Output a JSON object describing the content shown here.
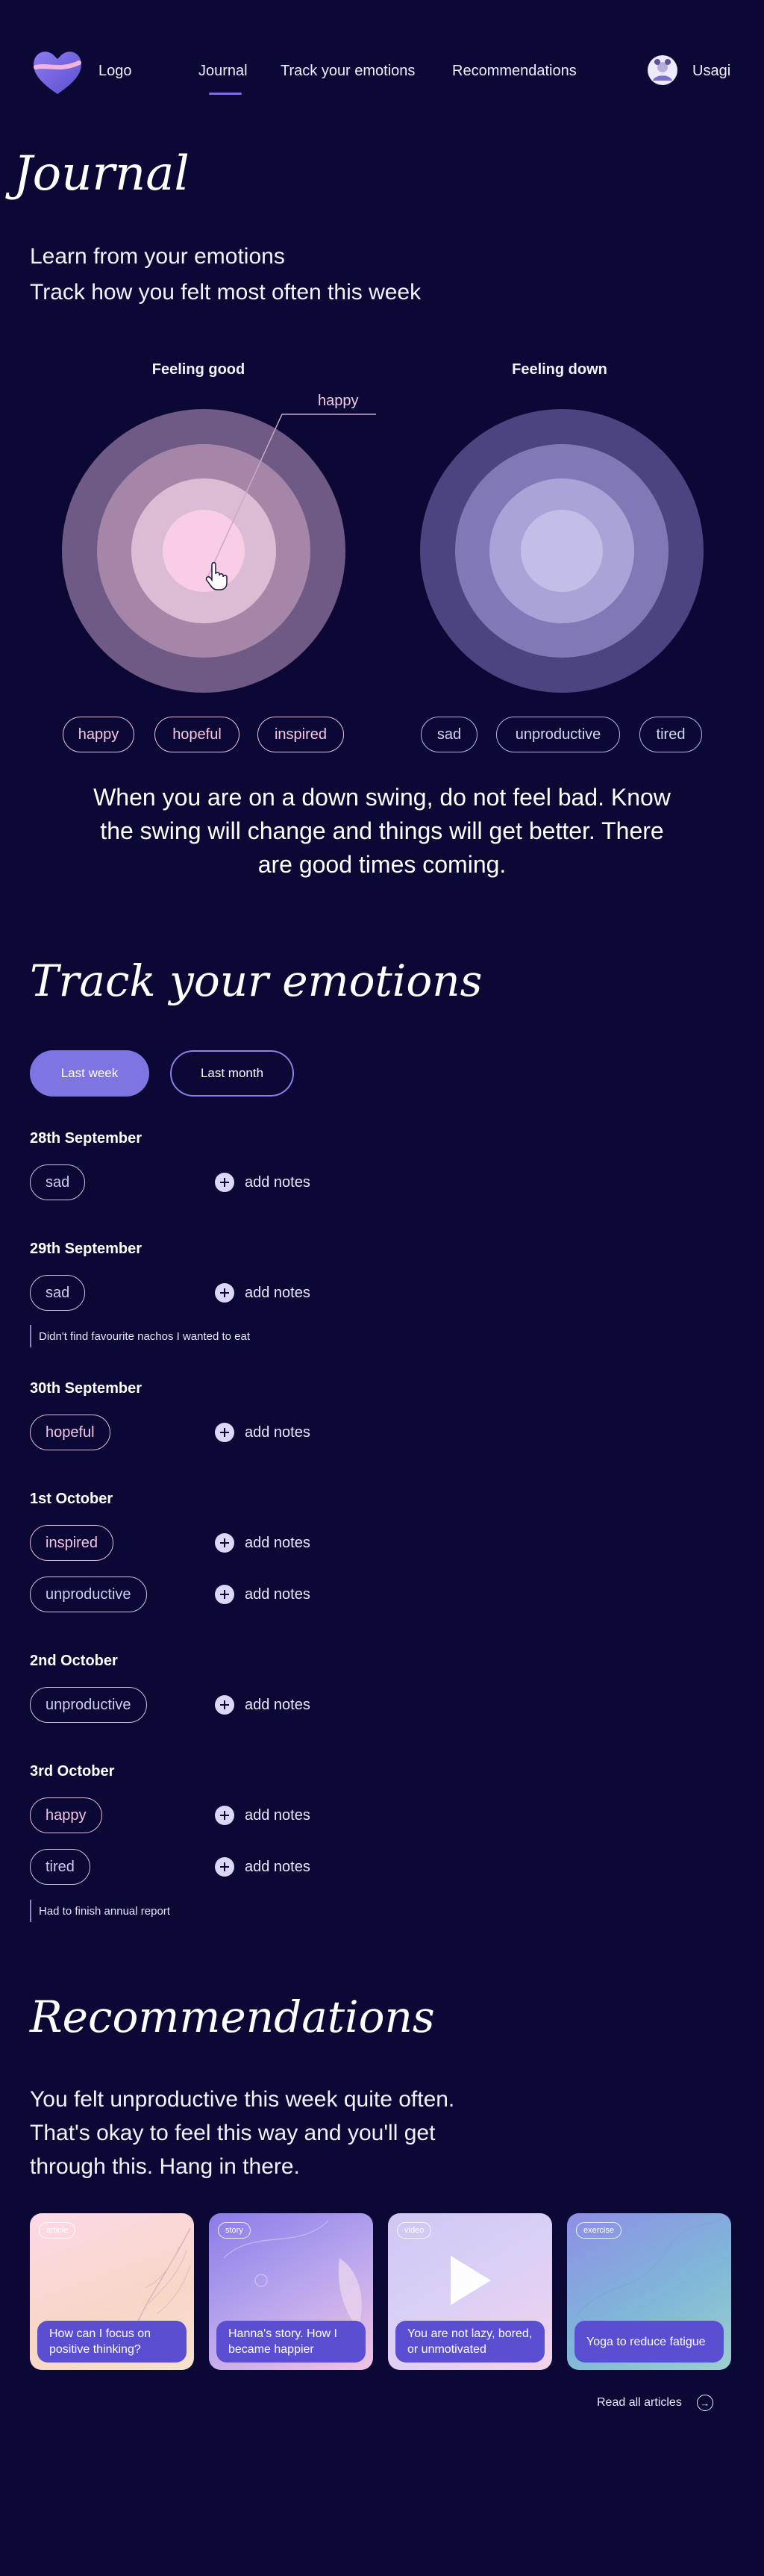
{
  "header": {
    "logo_text": "Logo",
    "nav": [
      "Journal",
      "Track your emotions",
      "Recommendations"
    ],
    "active_nav": "Journal",
    "user_name": "Usagi"
  },
  "journal": {
    "title": "Journal",
    "subtitle_line1": "Learn from your emotions",
    "subtitle_line2": "Track how you felt most often this week",
    "charts": [
      {
        "title": "Feeling good",
        "tooltip": "happy",
        "emotions": [
          "happy",
          "hopeful",
          "inspired"
        ],
        "colors": [
          "#6f5a85",
          "#a585a8",
          "#dcbcd4",
          "#f8cde5",
          "#ffd6ec"
        ]
      },
      {
        "title": "Feeling down",
        "emotions": [
          "sad",
          "unproductive",
          "tired"
        ],
        "colors": [
          "#4b4480",
          "#7f79b8",
          "#a8a4d8",
          "#c2bee8"
        ]
      }
    ],
    "quote": "When you are on a down swing, do not feel bad. Know the swing will change and things will get better. There are good times coming."
  },
  "tracker": {
    "title": "Track your emotions",
    "tabs": [
      "Last week",
      "Last month"
    ],
    "active_tab": "Last week",
    "add_notes_label": "add notes",
    "days": [
      {
        "date": "28th September",
        "emotions": [
          {
            "name": "sad",
            "tone": "blueish"
          }
        ],
        "note": ""
      },
      {
        "date": "29th September",
        "emotions": [
          {
            "name": "sad",
            "tone": "blueish"
          }
        ],
        "note": "Didn't find favourite nachos I wanted to eat"
      },
      {
        "date": "30th September",
        "emotions": [
          {
            "name": "hopeful",
            "tone": "pinkish"
          }
        ],
        "note": ""
      },
      {
        "date": "1st October",
        "emotions": [
          {
            "name": "inspired",
            "tone": "pinkish"
          },
          {
            "name": "unproductive",
            "tone": "blueish"
          }
        ],
        "note": ""
      },
      {
        "date": "2nd October",
        "emotions": [
          {
            "name": "unproductive",
            "tone": "blueish"
          }
        ],
        "note": ""
      },
      {
        "date": "3rd October",
        "emotions": [
          {
            "name": "happy",
            "tone": "pinkish"
          },
          {
            "name": "tired",
            "tone": "blueish"
          }
        ],
        "note": "Had to finish annual report"
      }
    ]
  },
  "recommendations": {
    "title": "Recommendations",
    "text": "You felt unproductive this week quite often. That's okay to feel this way and you'll get through this. Hang in there.",
    "cards": [
      {
        "tag": "article",
        "caption": "How can I focus on positive thinking?"
      },
      {
        "tag": "story",
        "caption": "Hanna's story. How I became happier"
      },
      {
        "tag": "video",
        "caption": "You are not lazy, bored, or unmotivated"
      },
      {
        "tag": "exercise",
        "caption": "Yoga to reduce fatigue"
      }
    ],
    "read_all": "Read all articles"
  },
  "colors": {
    "background": "#0b0836",
    "accent": "#7e74e2",
    "caption_bg": "#5a4fd1"
  }
}
